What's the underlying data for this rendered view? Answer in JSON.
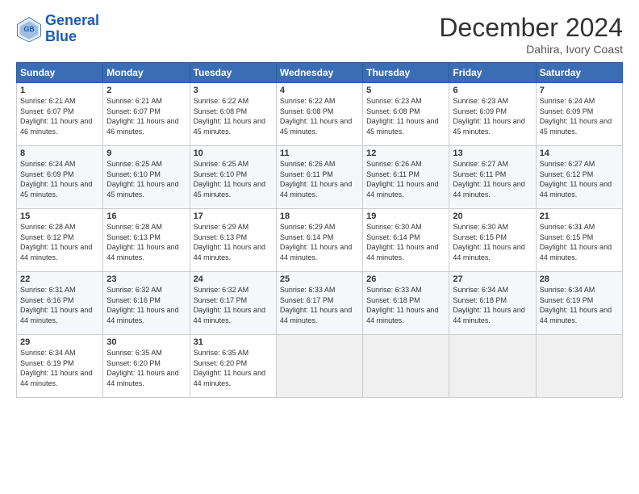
{
  "logo": {
    "general": "General",
    "blue": "Blue"
  },
  "header": {
    "month_year": "December 2024",
    "location": "Dahira, Ivory Coast"
  },
  "days": [
    "Sunday",
    "Monday",
    "Tuesday",
    "Wednesday",
    "Thursday",
    "Friday",
    "Saturday"
  ],
  "weeks": [
    [
      {
        "day": 1,
        "sunrise": "6:21 AM",
        "sunset": "6:07 PM",
        "daylight": "11 hours and 46 minutes."
      },
      {
        "day": 2,
        "sunrise": "6:21 AM",
        "sunset": "6:07 PM",
        "daylight": "11 hours and 46 minutes."
      },
      {
        "day": 3,
        "sunrise": "6:22 AM",
        "sunset": "6:08 PM",
        "daylight": "11 hours and 45 minutes."
      },
      {
        "day": 4,
        "sunrise": "6:22 AM",
        "sunset": "6:08 PM",
        "daylight": "11 hours and 45 minutes."
      },
      {
        "day": 5,
        "sunrise": "6:23 AM",
        "sunset": "6:08 PM",
        "daylight": "11 hours and 45 minutes."
      },
      {
        "day": 6,
        "sunrise": "6:23 AM",
        "sunset": "6:09 PM",
        "daylight": "11 hours and 45 minutes."
      },
      {
        "day": 7,
        "sunrise": "6:24 AM",
        "sunset": "6:09 PM",
        "daylight": "11 hours and 45 minutes."
      }
    ],
    [
      {
        "day": 8,
        "sunrise": "6:24 AM",
        "sunset": "6:09 PM",
        "daylight": "11 hours and 45 minutes."
      },
      {
        "day": 9,
        "sunrise": "6:25 AM",
        "sunset": "6:10 PM",
        "daylight": "11 hours and 45 minutes."
      },
      {
        "day": 10,
        "sunrise": "6:25 AM",
        "sunset": "6:10 PM",
        "daylight": "11 hours and 45 minutes."
      },
      {
        "day": 11,
        "sunrise": "6:26 AM",
        "sunset": "6:11 PM",
        "daylight": "11 hours and 44 minutes."
      },
      {
        "day": 12,
        "sunrise": "6:26 AM",
        "sunset": "6:11 PM",
        "daylight": "11 hours and 44 minutes."
      },
      {
        "day": 13,
        "sunrise": "6:27 AM",
        "sunset": "6:11 PM",
        "daylight": "11 hours and 44 minutes."
      },
      {
        "day": 14,
        "sunrise": "6:27 AM",
        "sunset": "6:12 PM",
        "daylight": "11 hours and 44 minutes."
      }
    ],
    [
      {
        "day": 15,
        "sunrise": "6:28 AM",
        "sunset": "6:12 PM",
        "daylight": "11 hours and 44 minutes."
      },
      {
        "day": 16,
        "sunrise": "6:28 AM",
        "sunset": "6:13 PM",
        "daylight": "11 hours and 44 minutes."
      },
      {
        "day": 17,
        "sunrise": "6:29 AM",
        "sunset": "6:13 PM",
        "daylight": "11 hours and 44 minutes."
      },
      {
        "day": 18,
        "sunrise": "6:29 AM",
        "sunset": "6:14 PM",
        "daylight": "11 hours and 44 minutes."
      },
      {
        "day": 19,
        "sunrise": "6:30 AM",
        "sunset": "6:14 PM",
        "daylight": "11 hours and 44 minutes."
      },
      {
        "day": 20,
        "sunrise": "6:30 AM",
        "sunset": "6:15 PM",
        "daylight": "11 hours and 44 minutes."
      },
      {
        "day": 21,
        "sunrise": "6:31 AM",
        "sunset": "6:15 PM",
        "daylight": "11 hours and 44 minutes."
      }
    ],
    [
      {
        "day": 22,
        "sunrise": "6:31 AM",
        "sunset": "6:16 PM",
        "daylight": "11 hours and 44 minutes."
      },
      {
        "day": 23,
        "sunrise": "6:32 AM",
        "sunset": "6:16 PM",
        "daylight": "11 hours and 44 minutes."
      },
      {
        "day": 24,
        "sunrise": "6:32 AM",
        "sunset": "6:17 PM",
        "daylight": "11 hours and 44 minutes."
      },
      {
        "day": 25,
        "sunrise": "6:33 AM",
        "sunset": "6:17 PM",
        "daylight": "11 hours and 44 minutes."
      },
      {
        "day": 26,
        "sunrise": "6:33 AM",
        "sunset": "6:18 PM",
        "daylight": "11 hours and 44 minutes."
      },
      {
        "day": 27,
        "sunrise": "6:34 AM",
        "sunset": "6:18 PM",
        "daylight": "11 hours and 44 minutes."
      },
      {
        "day": 28,
        "sunrise": "6:34 AM",
        "sunset": "6:19 PM",
        "daylight": "11 hours and 44 minutes."
      }
    ],
    [
      {
        "day": 29,
        "sunrise": "6:34 AM",
        "sunset": "6:19 PM",
        "daylight": "11 hours and 44 minutes."
      },
      {
        "day": 30,
        "sunrise": "6:35 AM",
        "sunset": "6:20 PM",
        "daylight": "11 hours and 44 minutes."
      },
      {
        "day": 31,
        "sunrise": "6:35 AM",
        "sunset": "6:20 PM",
        "daylight": "11 hours and 44 minutes."
      },
      null,
      null,
      null,
      null
    ]
  ],
  "labels": {
    "sunrise": "Sunrise:",
    "sunset": "Sunset:",
    "daylight": "Daylight:"
  }
}
